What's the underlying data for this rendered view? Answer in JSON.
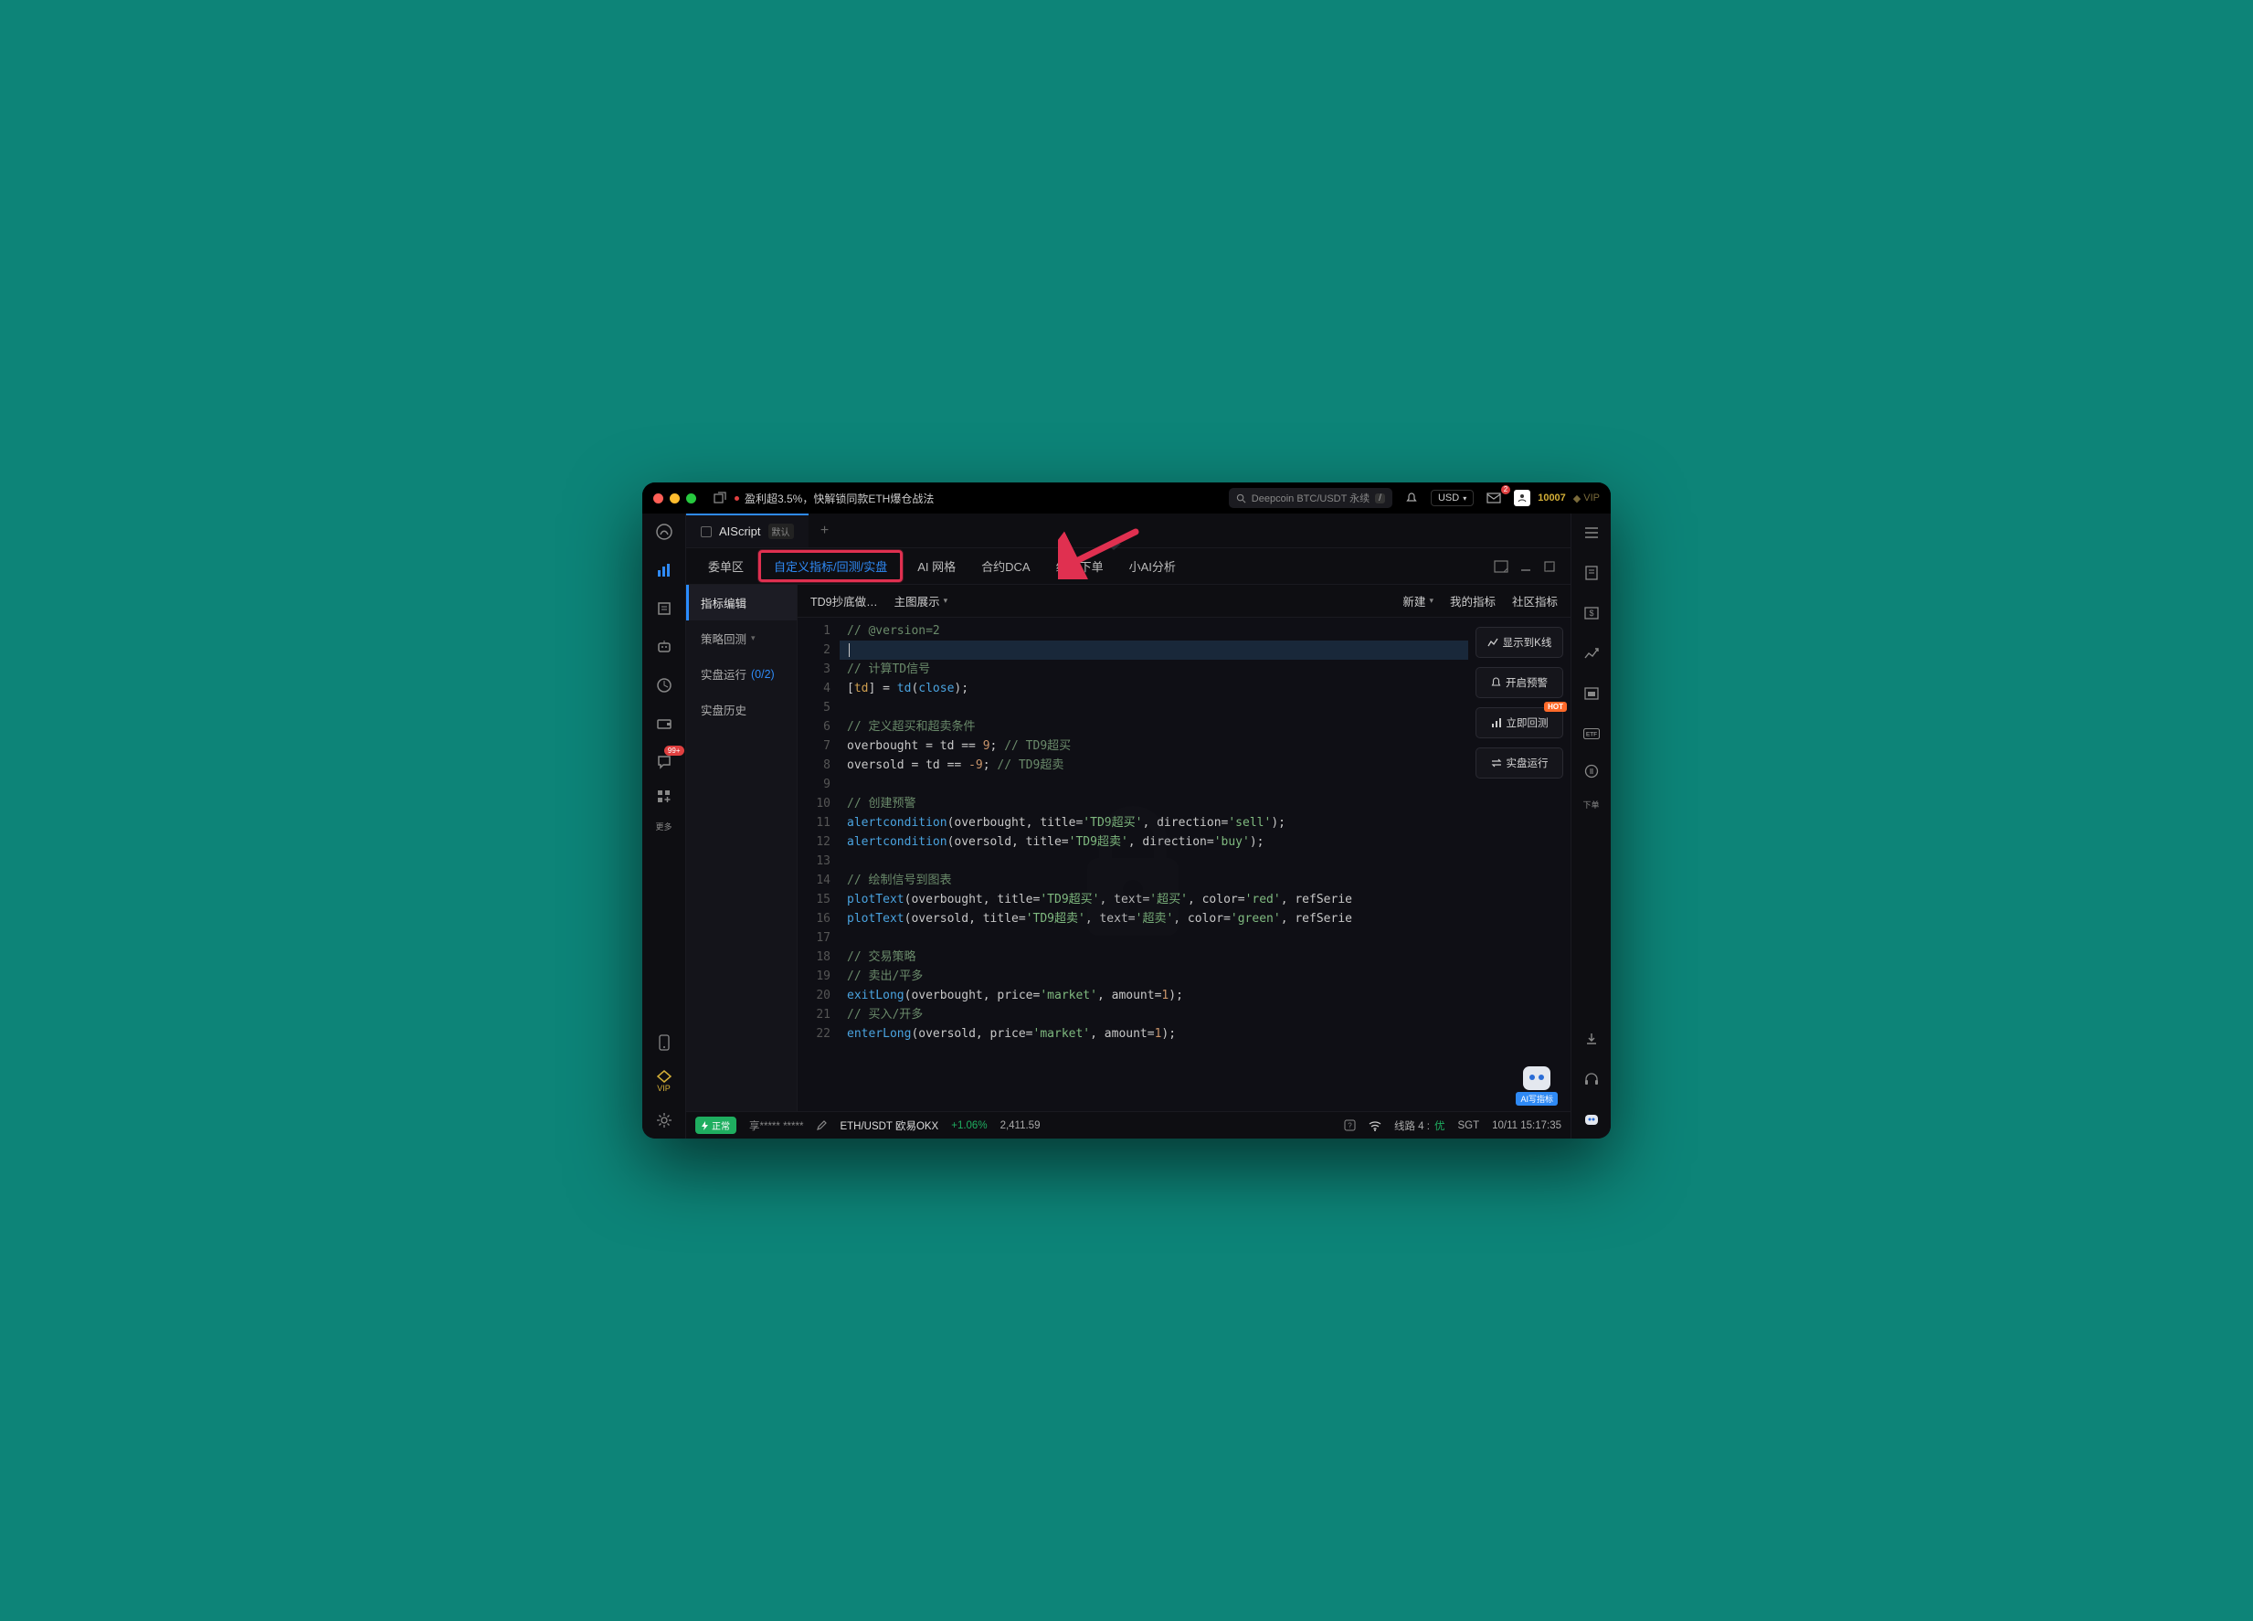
{
  "titlebar": {
    "promo": "盈利超3.5%，快解锁同款ETH爆仓战法",
    "search_placeholder": "Deepcoin BTC/USDT 永续",
    "currency": "USD",
    "mail_badge": "2",
    "points": "10007",
    "vip": "VIP"
  },
  "left_rail": {
    "more": "更多",
    "vip": "VIP",
    "chat_badge": "99+"
  },
  "right_rail": {
    "order": "下单"
  },
  "file_tab": {
    "name": "AIScript",
    "default_tag": "默认"
  },
  "toolbar": {
    "items": [
      "委单区",
      "自定义指标/回测/实盘",
      "AI 网格",
      "合约DCA",
      "组合下单",
      "小AI分析"
    ]
  },
  "side_panel": {
    "items": [
      {
        "label": "指标编辑",
        "active": true
      },
      {
        "label": "策略回测",
        "chevron": true
      },
      {
        "label": "实盘运行",
        "count": "(0/2)"
      },
      {
        "label": "实盘历史"
      }
    ]
  },
  "editor_top": {
    "script_name": "TD9抄底做…",
    "view_mode": "主图展示",
    "new": "新建",
    "my_indicators": "我的指标",
    "community": "社区指标"
  },
  "actions": {
    "show_on_kline": "显示到K线",
    "enable_alert": "开启预警",
    "backtest": "立即回测",
    "hot": "HOT",
    "live_run": "实盘运行"
  },
  "ai_float": "AI写指标",
  "code": {
    "lines": [
      {
        "n": 1,
        "seg": [
          {
            "c": "tok-c",
            "t": "// @version=2"
          }
        ]
      },
      {
        "n": 2,
        "hl": true,
        "seg": [
          {
            "c": "",
            "t": ""
          }
        ],
        "cursor": true
      },
      {
        "n": 3,
        "seg": [
          {
            "c": "tok-c",
            "t": "// 计算TD信号"
          }
        ]
      },
      {
        "n": 4,
        "seg": [
          {
            "c": "tok-op",
            "t": "["
          },
          {
            "c": "tok-id",
            "t": "td"
          },
          {
            "c": "tok-op",
            "t": "] = "
          },
          {
            "c": "tok-fn",
            "t": "td"
          },
          {
            "c": "tok-op",
            "t": "("
          },
          {
            "c": "tok-kw",
            "t": "close"
          },
          {
            "c": "tok-op",
            "t": ");"
          }
        ]
      },
      {
        "n": 5,
        "seg": []
      },
      {
        "n": 6,
        "seg": [
          {
            "c": "tok-c",
            "t": "// 定义超买和超卖条件"
          }
        ]
      },
      {
        "n": 7,
        "seg": [
          {
            "c": "",
            "t": "overbought = td == "
          },
          {
            "c": "tok-num",
            "t": "9"
          },
          {
            "c": "",
            "t": "; "
          },
          {
            "c": "tok-c",
            "t": "// TD9超买"
          }
        ]
      },
      {
        "n": 8,
        "seg": [
          {
            "c": "",
            "t": "oversold = td == "
          },
          {
            "c": "tok-num",
            "t": "-9"
          },
          {
            "c": "",
            "t": "; "
          },
          {
            "c": "tok-c",
            "t": "// TD9超卖"
          }
        ]
      },
      {
        "n": 9,
        "seg": []
      },
      {
        "n": 10,
        "seg": [
          {
            "c": "tok-c",
            "t": "// 创建预警"
          }
        ]
      },
      {
        "n": 11,
        "seg": [
          {
            "c": "tok-fn",
            "t": "alertcondition"
          },
          {
            "c": "",
            "t": "(overbought, title="
          },
          {
            "c": "tok-str",
            "t": "'TD9超买'"
          },
          {
            "c": "",
            "t": ", direction="
          },
          {
            "c": "tok-str",
            "t": "'sell'"
          },
          {
            "c": "",
            "t": ");"
          }
        ]
      },
      {
        "n": 12,
        "seg": [
          {
            "c": "tok-fn",
            "t": "alertcondition"
          },
          {
            "c": "",
            "t": "(oversold, title="
          },
          {
            "c": "tok-str",
            "t": "'TD9超卖'"
          },
          {
            "c": "",
            "t": ", direction="
          },
          {
            "c": "tok-str",
            "t": "'buy'"
          },
          {
            "c": "",
            "t": ");"
          }
        ]
      },
      {
        "n": 13,
        "seg": []
      },
      {
        "n": 14,
        "seg": [
          {
            "c": "tok-c",
            "t": "// 绘制信号到图表"
          }
        ]
      },
      {
        "n": 15,
        "seg": [
          {
            "c": "tok-fn",
            "t": "plotText"
          },
          {
            "c": "",
            "t": "(overbought, title="
          },
          {
            "c": "tok-str",
            "t": "'TD9超买'"
          },
          {
            "c": "",
            "t": ", text="
          },
          {
            "c": "tok-str",
            "t": "'超买'"
          },
          {
            "c": "",
            "t": ", color="
          },
          {
            "c": "tok-str",
            "t": "'red'"
          },
          {
            "c": "",
            "t": ", refSerie"
          }
        ]
      },
      {
        "n": 16,
        "seg": [
          {
            "c": "tok-fn",
            "t": "plotText"
          },
          {
            "c": "",
            "t": "(oversold, title="
          },
          {
            "c": "tok-str",
            "t": "'TD9超卖'"
          },
          {
            "c": "",
            "t": ", text="
          },
          {
            "c": "tok-str",
            "t": "'超卖'"
          },
          {
            "c": "",
            "t": ", color="
          },
          {
            "c": "tok-str",
            "t": "'green'"
          },
          {
            "c": "",
            "t": ", refSerie"
          }
        ]
      },
      {
        "n": 17,
        "seg": []
      },
      {
        "n": 18,
        "seg": [
          {
            "c": "tok-c",
            "t": "// 交易策略"
          }
        ]
      },
      {
        "n": 19,
        "seg": [
          {
            "c": "tok-c",
            "t": "// 卖出/平多"
          }
        ]
      },
      {
        "n": 20,
        "seg": [
          {
            "c": "tok-fn",
            "t": "exitLong"
          },
          {
            "c": "",
            "t": "(overbought, price="
          },
          {
            "c": "tok-str",
            "t": "'market'"
          },
          {
            "c": "",
            "t": ", amount="
          },
          {
            "c": "tok-num",
            "t": "1"
          },
          {
            "c": "",
            "t": ");"
          }
        ]
      },
      {
        "n": 21,
        "seg": [
          {
            "c": "tok-c",
            "t": "// 买入/开多"
          }
        ]
      },
      {
        "n": 22,
        "seg": [
          {
            "c": "tok-fn",
            "t": "enterLong"
          },
          {
            "c": "",
            "t": "(oversold, price="
          },
          {
            "c": "tok-str",
            "t": "'market'"
          },
          {
            "c": "",
            "t": ", amount="
          },
          {
            "c": "tok-num",
            "t": "1"
          },
          {
            "c": "",
            "t": ");"
          }
        ]
      }
    ]
  },
  "statusbar": {
    "status": "正常",
    "account": "享***** *****",
    "symbol": "ETH/USDT 欧易OKX",
    "change_pct": "+1.06%",
    "price": "2,411.59",
    "route_label": "线路 4 :",
    "route_quality": "优",
    "tz": "SGT",
    "datetime": "10/11 15:17:35"
  }
}
